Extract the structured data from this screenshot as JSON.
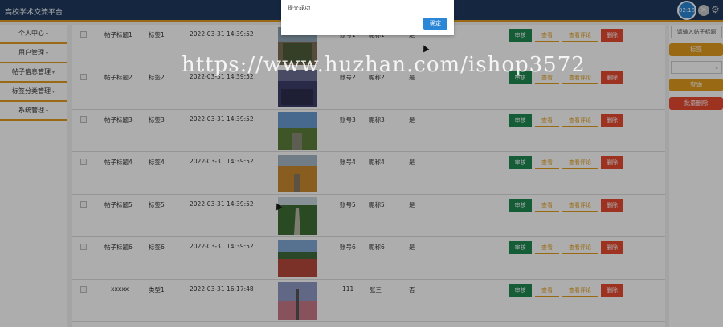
{
  "app": {
    "title": "高校学术交流平台",
    "timer": "02:18"
  },
  "sidebar": {
    "items": [
      {
        "label": "个人中心"
      },
      {
        "label": "用户管理"
      },
      {
        "label": "帖子信息管理"
      },
      {
        "label": "标签分类管理"
      },
      {
        "label": "系统管理"
      }
    ]
  },
  "table": {
    "action_labels": {
      "audit": "审核",
      "view": "查看",
      "comments": "查看评论",
      "delete": "删除"
    },
    "rows": [
      {
        "title": "帖子标题1",
        "tag": "标签1",
        "time": "2022-03-31 14:39:52",
        "account": "账号1",
        "nickname": "昵称1",
        "flag": "是"
      },
      {
        "title": "帖子标题2",
        "tag": "标签2",
        "time": "2022-03-31 14:39:52",
        "account": "账号2",
        "nickname": "昵称2",
        "flag": "是"
      },
      {
        "title": "帖子标题3",
        "tag": "标签3",
        "time": "2022-03-31 14:39:52",
        "account": "账号3",
        "nickname": "昵称3",
        "flag": "是"
      },
      {
        "title": "帖子标题4",
        "tag": "标签4",
        "time": "2022-03-31 14:39:52",
        "account": "账号4",
        "nickname": "昵称4",
        "flag": "是"
      },
      {
        "title": "帖子标题5",
        "tag": "标签5",
        "time": "2022-03-31 14:39:52",
        "account": "账号5",
        "nickname": "昵称5",
        "flag": "是"
      },
      {
        "title": "帖子标题6",
        "tag": "标签6",
        "time": "2022-03-31 14:39:52",
        "account": "账号6",
        "nickname": "昵称6",
        "flag": "是"
      },
      {
        "title": "xxxxx",
        "tag": "类型1",
        "time": "2022-03-31 16:17:48",
        "account": "111",
        "nickname": "张三",
        "flag": "否"
      }
    ]
  },
  "panel": {
    "search_placeholder": "请输入帖子标题",
    "tag_label": "标签",
    "select_value": "",
    "search_button": "查询",
    "batch_delete": "批量删除"
  },
  "dialog": {
    "message": "提交成功",
    "ok_label": "确定"
  },
  "watermark": "https://www.huzhan.com/ishop3572",
  "colors": {
    "header": "#1f3a5f",
    "accent": "#e29d1c",
    "audit": "#1e8a52",
    "delete": "#e84a32",
    "primary": "#2a86d6"
  }
}
